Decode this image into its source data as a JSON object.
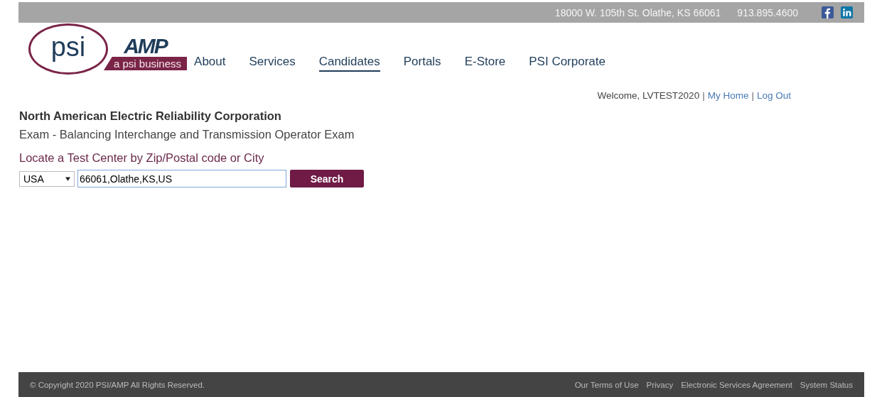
{
  "top_bar": {
    "address": "18000 W. 105th St. Olathe, KS 66061",
    "phone": "913.895.4600"
  },
  "logo": {
    "circle_text": "psi",
    "brand": "AMP",
    "tagline": "a psi business"
  },
  "nav": [
    {
      "label": "About",
      "selected": false
    },
    {
      "label": "Services",
      "selected": false
    },
    {
      "label": "Candidates",
      "selected": true
    },
    {
      "label": "Portals",
      "selected": false
    },
    {
      "label": "E-Store",
      "selected": false
    },
    {
      "label": "PSI Corporate",
      "selected": false
    }
  ],
  "user_bar": {
    "welcome": "Welcome, LVTEST2020",
    "separator_1": "|",
    "my_home": "My Home",
    "separator_2": "|",
    "log_out": "Log Out"
  },
  "organization": "North American Electric Reliability Corporation",
  "exam": "Exam - Balancing Interchange and Transmission Operator Exam",
  "locate_heading": "Locate a Test Center by Zip/Postal code or City",
  "search_form": {
    "country": "USA",
    "location": "66061,Olathe,KS,US",
    "button": "Search"
  },
  "footer": {
    "copyright": "© Copyright 2020 PSI/AMP All Rights Reserved.",
    "links": [
      "Our Terms of Use",
      "Privacy",
      "Electronic Services Agreement",
      "System Status"
    ]
  }
}
